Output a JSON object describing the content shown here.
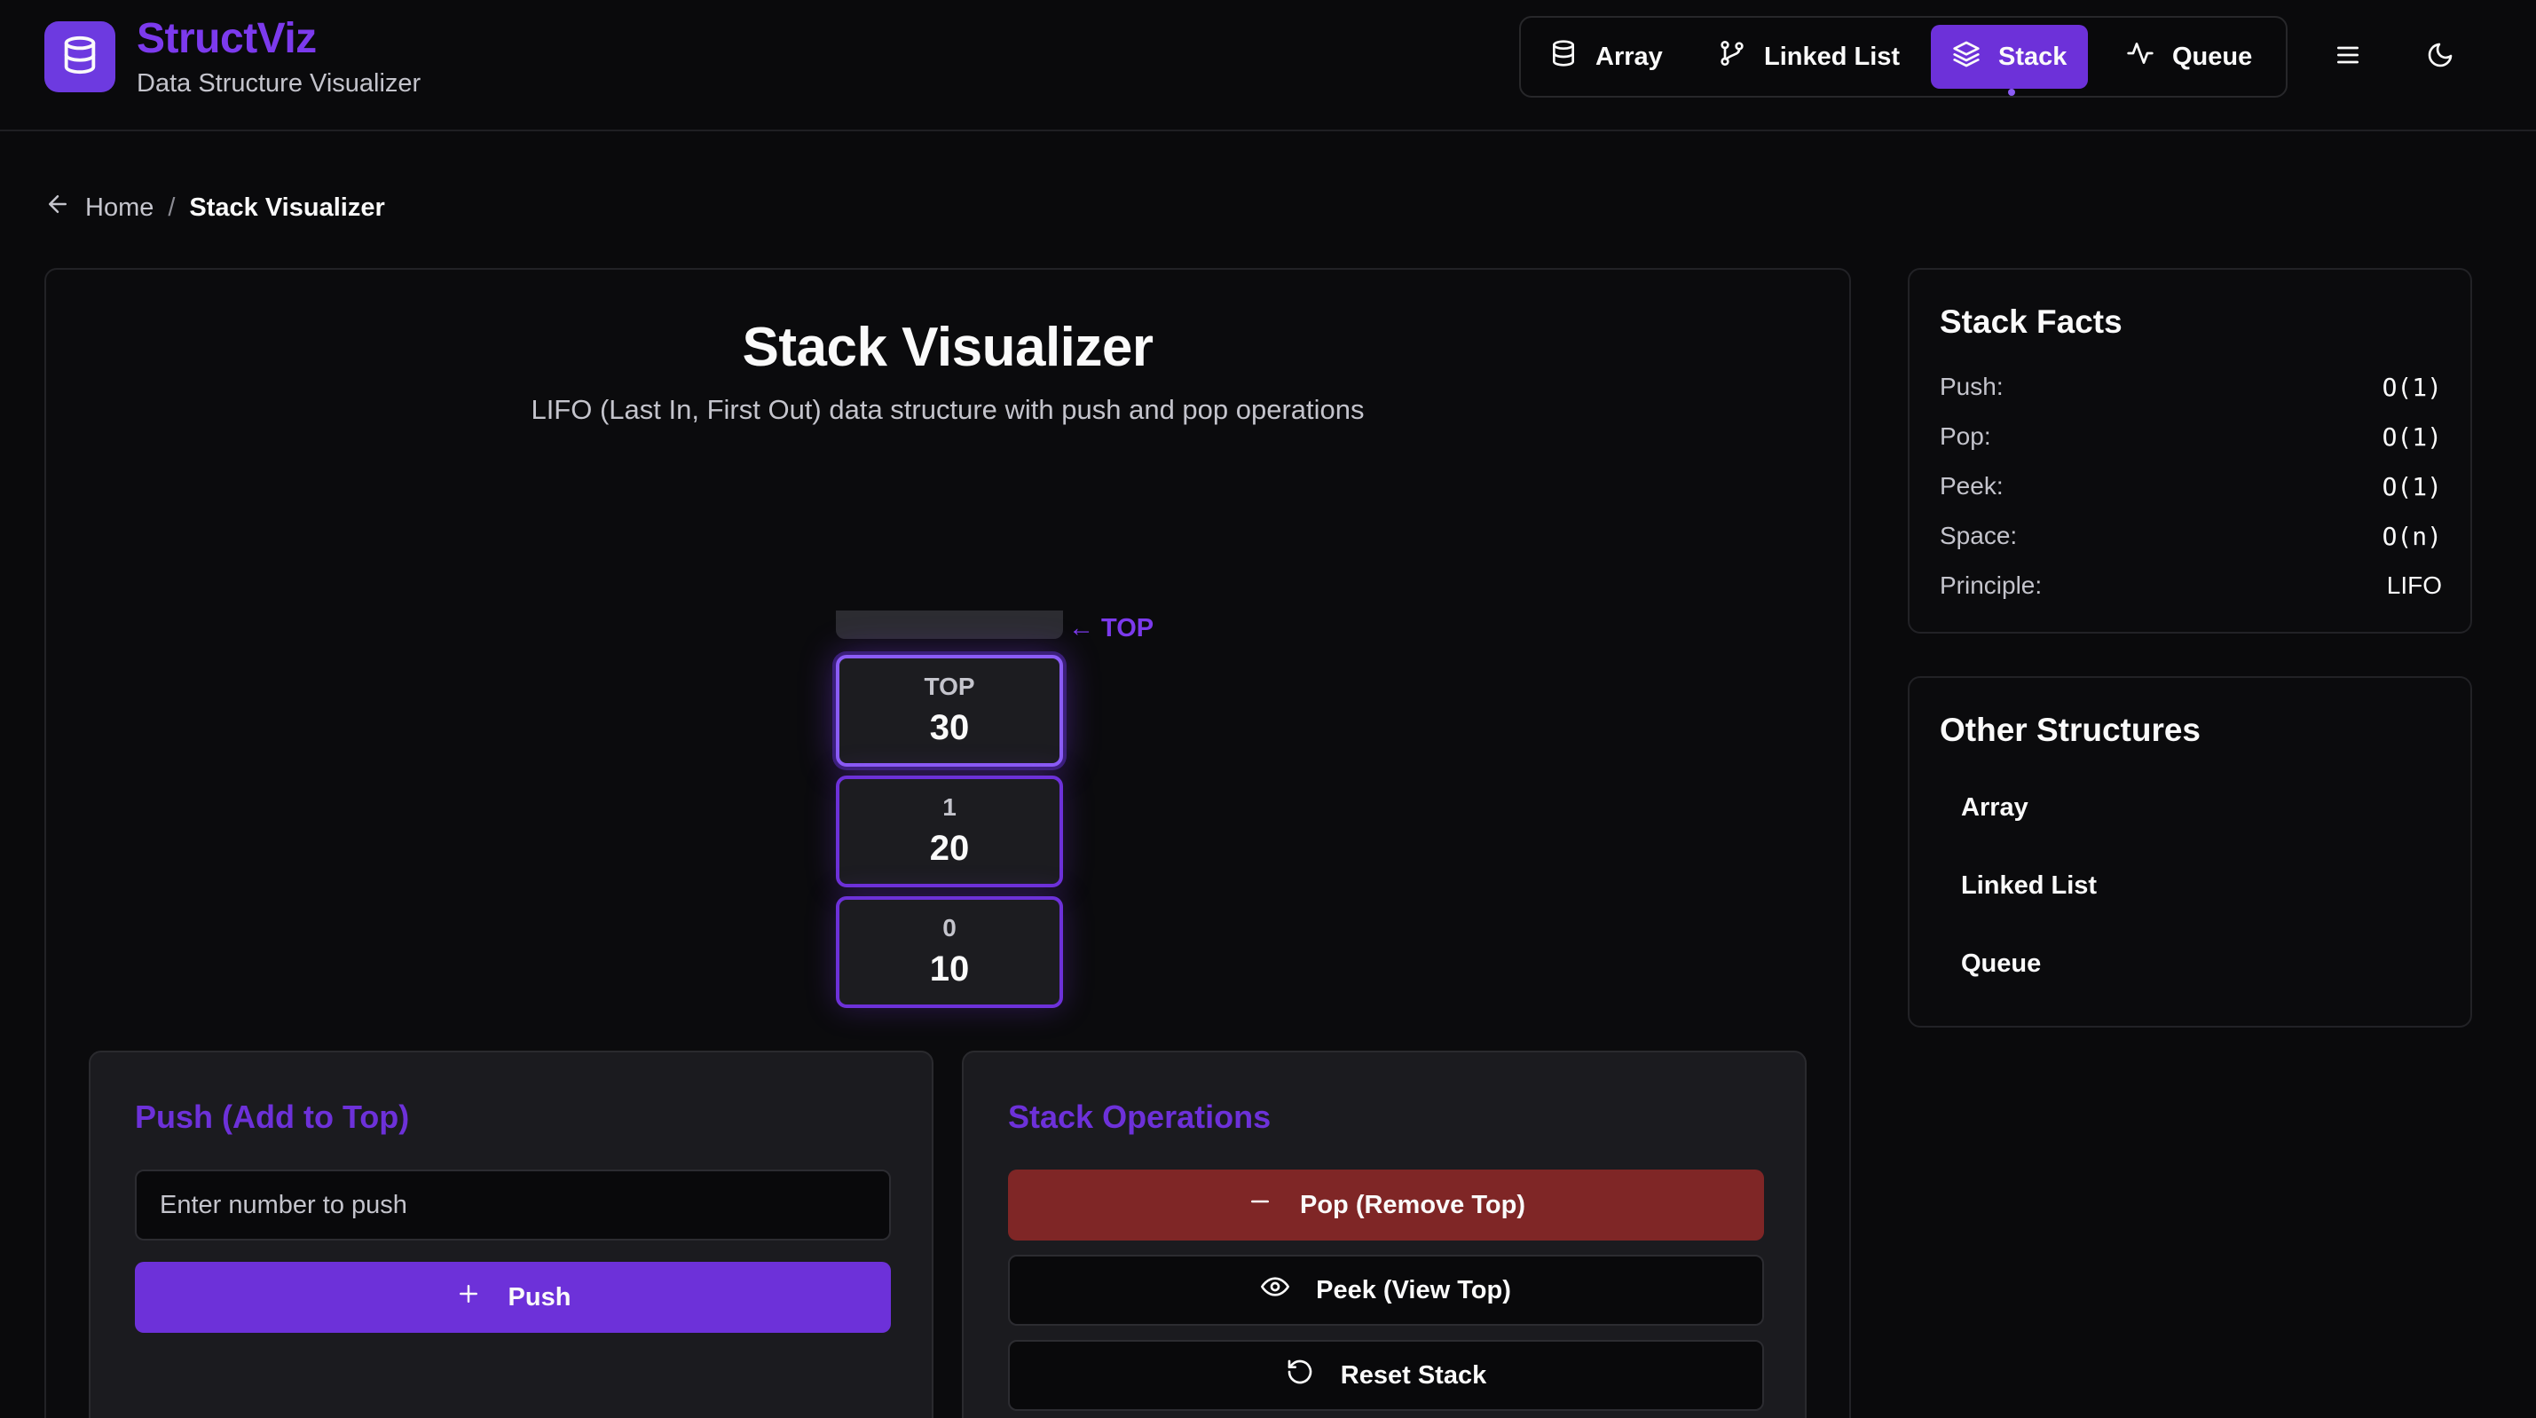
{
  "header": {
    "brand_name": "StructViz",
    "brand_subtitle": "Data Structure Visualizer",
    "logo_icon": "database-icon",
    "nav": [
      {
        "label": "Array",
        "icon": "database-icon",
        "active": false
      },
      {
        "label": "Linked List",
        "icon": "git-branch-icon",
        "active": false
      },
      {
        "label": "Stack",
        "icon": "layers-icon",
        "active": true
      },
      {
        "label": "Queue",
        "icon": "activity-icon",
        "active": false
      }
    ],
    "menu_icon": "menu-icon",
    "theme_icon": "moon-icon"
  },
  "breadcrumb": {
    "home": "Home",
    "separator": "/",
    "current": "Stack Visualizer"
  },
  "main": {
    "title": "Stack Visualizer",
    "subtitle": "LIFO (Last In, First Out) data structure with push and pop operations",
    "top_indicator": "← TOP",
    "stack": [
      {
        "label": "TOP",
        "value": "30"
      },
      {
        "label": "1",
        "value": "20"
      },
      {
        "label": "0",
        "value": "10"
      }
    ],
    "push_card": {
      "title": "Push (Add to Top)",
      "input_placeholder": "Enter number to push",
      "input_value": "",
      "button_label": "Push"
    },
    "ops_card": {
      "title": "Stack Operations",
      "pop_label": "Pop (Remove Top)",
      "peek_label": "Peek (View Top)",
      "reset_label": "Reset Stack"
    }
  },
  "sidebar": {
    "facts_title": "Stack Facts",
    "facts": [
      {
        "key": "Push:",
        "value": "O(1)"
      },
      {
        "key": "Pop:",
        "value": "O(1)"
      },
      {
        "key": "Peek:",
        "value": "O(1)"
      },
      {
        "key": "Space:",
        "value": "O(n)"
      },
      {
        "key": "Principle:",
        "value": "LIFO"
      }
    ],
    "other_title": "Other Structures",
    "other_links": [
      "Array",
      "Linked List",
      "Queue"
    ]
  },
  "colors": {
    "accent": "#6d31d9",
    "accent_text": "#7c3aed",
    "danger": "#7f2626",
    "background": "#0a0a0c"
  }
}
